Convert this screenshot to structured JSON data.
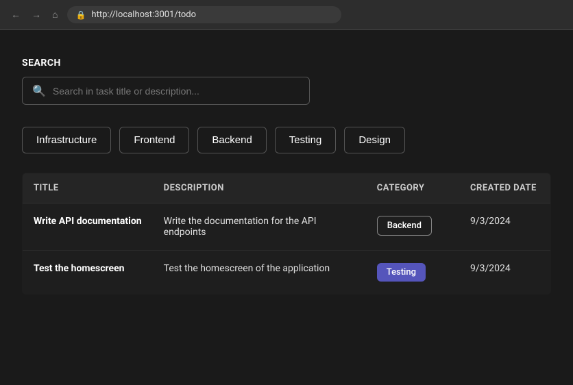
{
  "browser": {
    "url": "http://localhost:3001/todo"
  },
  "search": {
    "label": "SEARCH",
    "placeholder": "Search in task title or description..."
  },
  "filters": {
    "buttons": [
      {
        "id": "infrastructure",
        "label": "Infrastructure",
        "active": false
      },
      {
        "id": "frontend",
        "label": "Frontend",
        "active": false
      },
      {
        "id": "backend",
        "label": "Backend",
        "active": false
      },
      {
        "id": "testing",
        "label": "Testing",
        "active": false
      },
      {
        "id": "design",
        "label": "Design",
        "active": false
      }
    ]
  },
  "table": {
    "columns": [
      {
        "id": "title",
        "label": "TITLE"
      },
      {
        "id": "description",
        "label": "DESCRIPTION"
      },
      {
        "id": "category",
        "label": "CATEGORY"
      },
      {
        "id": "created_date",
        "label": "CREATED DATE"
      }
    ],
    "rows": [
      {
        "title": "Write API documentation",
        "description": "Write the documentation for the API endpoints",
        "category": "Backend",
        "category_type": "backend",
        "created_date": "9/3/2024"
      },
      {
        "title": "Test the homescreen",
        "description": "Test the homescreen of the application",
        "category": "Testing",
        "category_type": "testing",
        "created_date": "9/3/2024"
      }
    ]
  }
}
